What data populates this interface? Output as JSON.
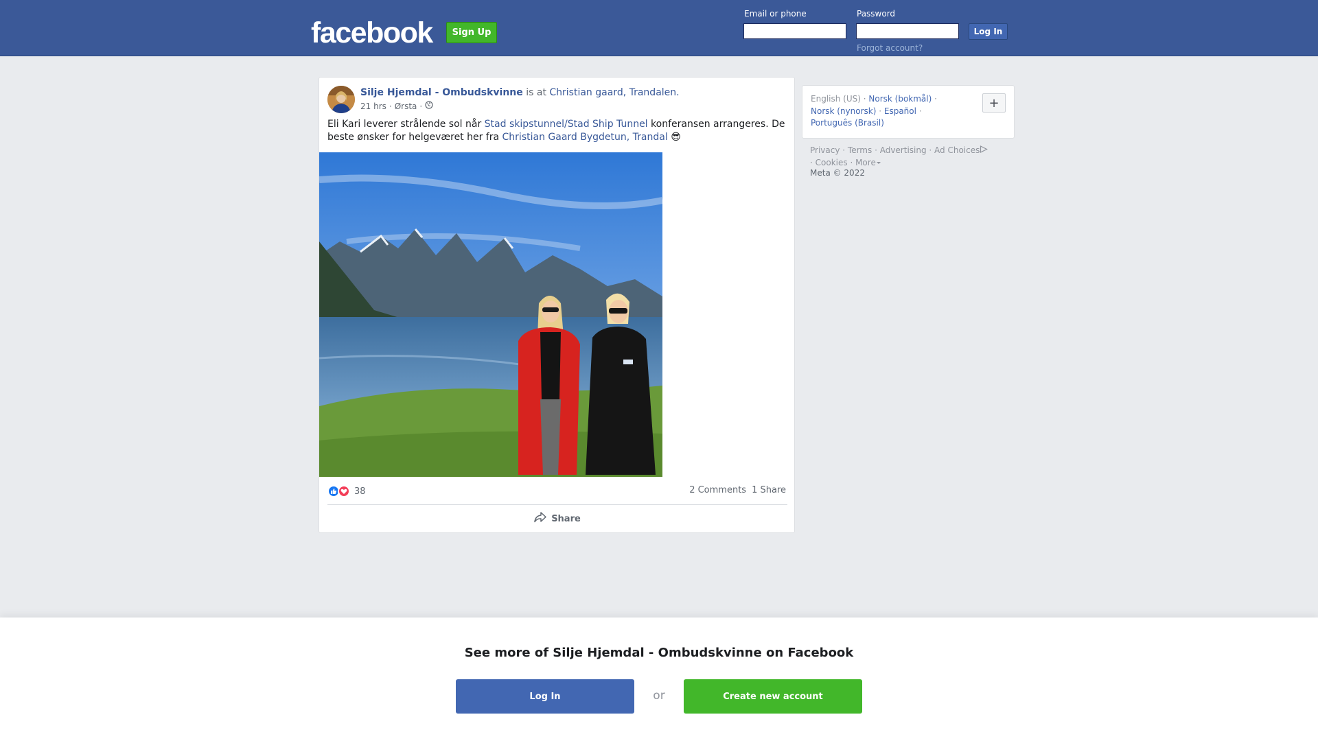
{
  "header": {
    "logo": "facebook",
    "signup_label": "Sign Up",
    "email_label": "Email or phone",
    "email_value": "",
    "password_label": "Password",
    "password_value": "",
    "login_label": "Log In",
    "forgot_label": "Forgot account?"
  },
  "post": {
    "author": "Silje Hjemdal - Ombudskvinne",
    "is_at": " is at ",
    "place": "Christian gaard, Trandalen.",
    "time": "21 hrs",
    "sep": "·",
    "location": "Ørsta",
    "privacy_icon": "globe-icon",
    "text_1": "Eli Kari leverer strålende sol når ",
    "link_1": "Stad skipstunnel/Stad Ship Tunnel",
    "text_2": " konferansen arrangeres. De beste ønsker for helgeværet her fra ",
    "link_2": "Christian Gaard Bygdetun, Trandal",
    "emoji": "😎",
    "reaction_icons": [
      "like-icon",
      "love-icon"
    ],
    "reaction_count": "38",
    "comments": "2 Comments",
    "shares": "1 Share",
    "share_label": "Share"
  },
  "sidebar": {
    "languages": [
      {
        "label": "English (US)",
        "active": false
      },
      {
        "label": "Norsk (bokmål)",
        "active": true
      },
      {
        "label": "Norsk (nynorsk)",
        "active": true
      },
      {
        "label": "Español",
        "active": true
      },
      {
        "label": "Português (Brasil)",
        "active": true
      }
    ],
    "plus_label": "+",
    "dot": " · ",
    "links": [
      "Privacy",
      "Terms",
      "Advertising",
      "Ad Choices",
      "Cookies",
      "More"
    ],
    "copyright": "Meta © 2022"
  },
  "bottom": {
    "title": "See more of Silje Hjemdal - Ombudskvinne on Facebook",
    "login_label": "Log In",
    "or_label": "or",
    "create_label": "Create new account"
  },
  "colors": {
    "brand_blue": "#3b5998",
    "link_blue": "#385898",
    "green": "#42b72a",
    "page_bg": "#e9ebee"
  }
}
